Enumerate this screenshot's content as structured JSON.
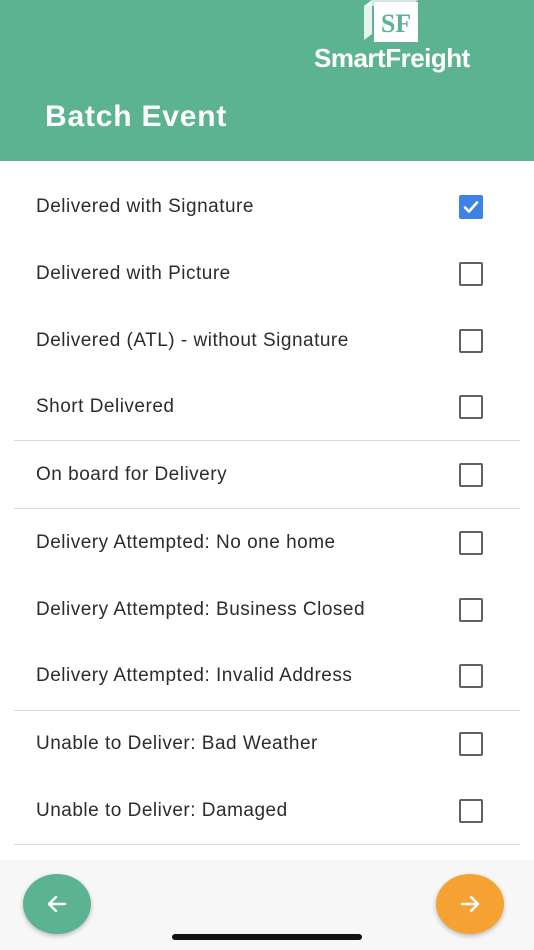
{
  "header": {
    "brand_mark": "SF",
    "brand_name": "SmartFreight",
    "title": "Batch Event",
    "color": "#5bb391"
  },
  "events": [
    {
      "label": "Delivered with Signature",
      "checked": true
    },
    {
      "label": "Delivered with Picture",
      "checked": false
    },
    {
      "label": "Delivered (ATL) - without Signature",
      "checked": false
    },
    {
      "label": "Short Delivered",
      "checked": false
    },
    {
      "label": "On board for Delivery",
      "checked": false
    },
    {
      "label": "Delivery Attempted: No one home",
      "checked": false
    },
    {
      "label": "Delivery Attempted: Business Closed",
      "checked": false
    },
    {
      "label": "Delivery Attempted: Invalid Address",
      "checked": false
    },
    {
      "label": "Unable to Deliver: Bad Weather",
      "checked": false
    },
    {
      "label": "Unable to Deliver: Damaged",
      "checked": false
    }
  ],
  "footer": {
    "back_button": {
      "icon": "arrow-left-icon",
      "color": "#5bb391"
    },
    "next_button": {
      "icon": "arrow-right-icon",
      "color": "#f5a233"
    }
  },
  "accent_check_color": "#3e82e5"
}
